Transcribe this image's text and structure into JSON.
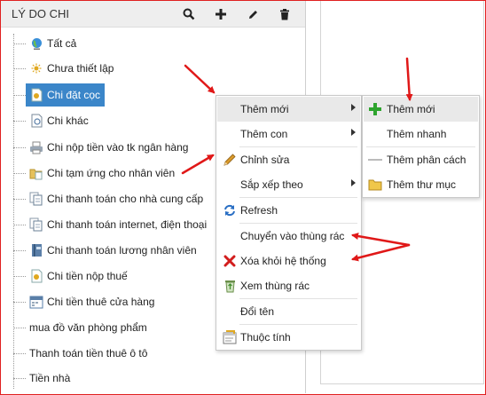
{
  "panel": {
    "title": "LÝ DO CHI",
    "header_icons": [
      "search-icon",
      "plus-icon",
      "pencil-icon",
      "trash-icon"
    ]
  },
  "tree": {
    "items": [
      {
        "label": "Tất cả",
        "icon": "globe-icon"
      },
      {
        "label": "Chưa thiết lập",
        "icon": "sun-icon"
      },
      {
        "label": "Chi đặt cọc",
        "icon": "document-star-icon",
        "selected": true
      },
      {
        "label": "Chi khác",
        "icon": "document-icon"
      },
      {
        "label": "Chi nộp tiền vào tk ngân hàng",
        "icon": "printer-icon"
      },
      {
        "label": "Chi tạm ứng cho nhân viên",
        "icon": "folder-doc-icon"
      },
      {
        "label": "Chi thanh toán cho nhà cung cấp",
        "icon": "documents-icon"
      },
      {
        "label": "Chi thanh toán internet, điện thoại",
        "icon": "documents-icon"
      },
      {
        "label": "Chi thanh toán lương nhân viên",
        "icon": "book-icon"
      },
      {
        "label": "Chi tiền nộp thuế",
        "icon": "document-star-icon"
      },
      {
        "label": "Chi tiền thuê cửa hàng",
        "icon": "calendar-icon"
      },
      {
        "label": "mua đồ văn phòng phẩm",
        "icon": ""
      },
      {
        "label": "Thanh toán tiền thuê ô tô",
        "icon": ""
      },
      {
        "label": "Tiền nhà",
        "icon": ""
      }
    ]
  },
  "context_menu": {
    "items": [
      {
        "label": "Thêm mới",
        "icon": "",
        "submenu": true,
        "highlighted": true
      },
      {
        "label": "Thêm con",
        "icon": "",
        "submenu": true
      },
      {
        "label": "Chỉnh sửa",
        "icon": "pencil-icon"
      },
      {
        "label": "Sắp xếp theo",
        "icon": "",
        "submenu": true
      },
      {
        "label": "Refresh",
        "icon": "refresh-icon"
      },
      {
        "label": "Chuyển vào thùng rác",
        "icon": ""
      },
      {
        "label": "Xóa khỏi hệ thống",
        "icon": "red-x-icon"
      },
      {
        "label": "Xem thùng rác",
        "icon": "recycle-bin-icon"
      },
      {
        "label": "Đổi tên",
        "icon": ""
      },
      {
        "label": "Thuộc tính",
        "icon": "properties-icon"
      }
    ]
  },
  "submenu": {
    "items": [
      {
        "label": "Thêm mới",
        "icon": "green-plus-icon",
        "highlighted": true
      },
      {
        "label": "Thêm nhanh",
        "icon": ""
      },
      {
        "label": "Thêm phân cách",
        "icon": "line-icon"
      },
      {
        "label": "Thêm thư mục",
        "icon": "folder-icon"
      }
    ]
  },
  "colors": {
    "selection": "#3b86c9",
    "annotation_arrow": "#e01818",
    "menu_highlight": "#e9e9e9",
    "frame_border": "#e02020"
  }
}
